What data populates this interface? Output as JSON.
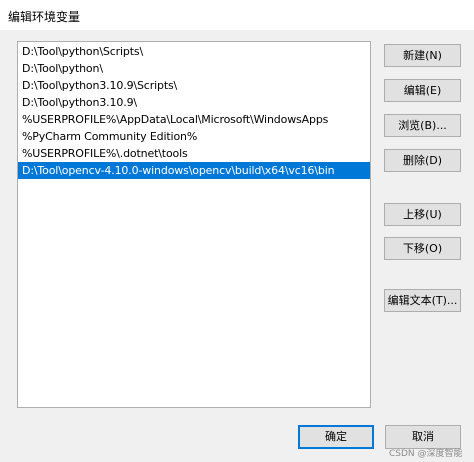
{
  "window": {
    "title": "编辑环境变量"
  },
  "list": {
    "items": [
      "D:\\Tool\\python\\Scripts\\",
      "D:\\Tool\\python\\",
      "D:\\Tool\\python3.10.9\\Scripts\\",
      "D:\\Tool\\python3.10.9\\",
      "%USERPROFILE%\\AppData\\Local\\Microsoft\\WindowsApps",
      "%PyCharm Community Edition%",
      "%USERPROFILE%\\.dotnet\\tools",
      "D:\\Tool\\opencv-4.10.0-windows\\opencv\\build\\x64\\vc16\\bin"
    ],
    "selected_index": 7
  },
  "buttons": {
    "new": "新建(N)",
    "edit": "编辑(E)",
    "browse": "浏览(B)...",
    "delete": "删除(D)",
    "move_up": "上移(U)",
    "move_down": "下移(O)",
    "edit_text": "编辑文本(T)...",
    "ok": "确定",
    "cancel": "取消"
  },
  "watermark": "CSDN @深度智能",
  "colors": {
    "selection": "#0078d7",
    "default_button_border": "#0078d7"
  }
}
